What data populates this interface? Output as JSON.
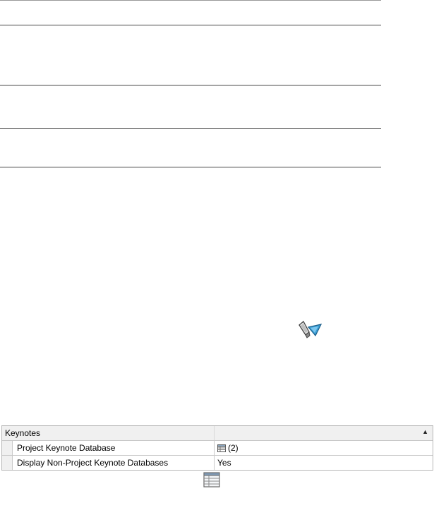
{
  "icons": {
    "tool": "keynote-tag-tool-icon",
    "table": "table-icon"
  },
  "property_grid": {
    "category": "Keynotes",
    "toggle_glyph": "▲",
    "rows": [
      {
        "name": "Project Keynote Database",
        "value": "(2)",
        "has_table_icon": true
      },
      {
        "name": "Display Non-Project Keynote Databases",
        "value": "Yes",
        "has_table_icon": false
      }
    ]
  },
  "colors": {
    "accent": "#3b9fd6",
    "grid_border": "#b8b8b8",
    "category_bg": "#f0f0f0"
  }
}
